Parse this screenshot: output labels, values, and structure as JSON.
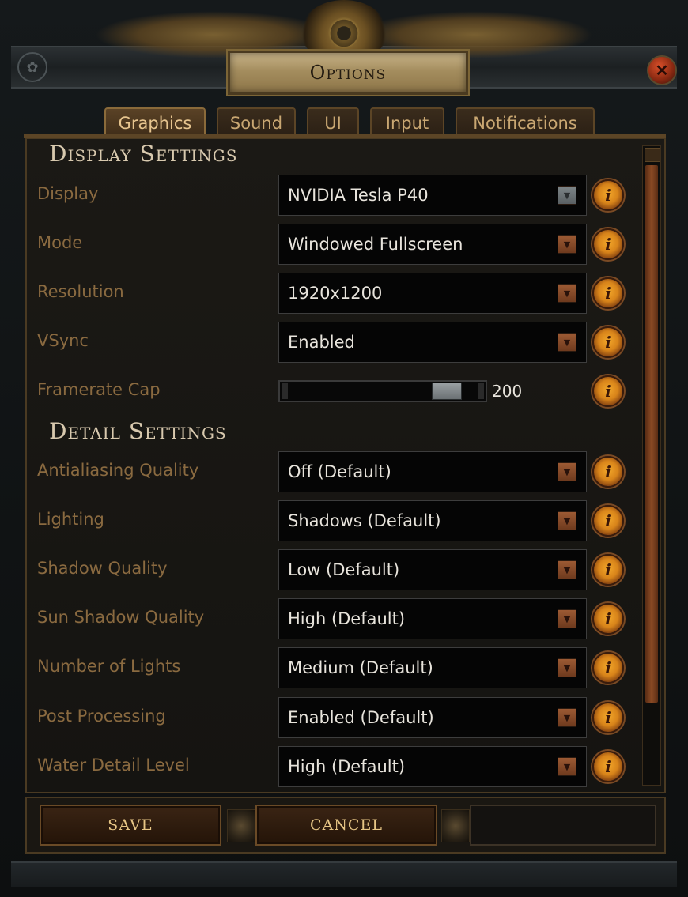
{
  "window": {
    "title": "Options",
    "close_icon": "close-icon"
  },
  "tabs": [
    {
      "label": "Graphics",
      "active": true
    },
    {
      "label": "Sound",
      "active": false
    },
    {
      "label": "UI",
      "active": false
    },
    {
      "label": "Input",
      "active": false
    },
    {
      "label": "Notifications",
      "active": false
    }
  ],
  "sections": {
    "display": {
      "title": "Display Settings"
    },
    "detail": {
      "title": "Detail Settings"
    }
  },
  "display_settings": [
    {
      "label": "Display",
      "value": "NVIDIA Tesla P40"
    },
    {
      "label": "Mode",
      "value": "Windowed Fullscreen"
    },
    {
      "label": "Resolution",
      "value": "1920x1200"
    },
    {
      "label": "VSync",
      "value": "Enabled"
    }
  ],
  "framerate": {
    "label": "Framerate Cap",
    "value": "200",
    "fraction": 0.9
  },
  "detail_settings": [
    {
      "label": "Antialiasing Quality",
      "value": "Off (Default)"
    },
    {
      "label": "Lighting",
      "value": "Shadows (Default)"
    },
    {
      "label": "Shadow Quality",
      "value": "Low (Default)"
    },
    {
      "label": "Sun Shadow Quality",
      "value": "High (Default)"
    },
    {
      "label": "Number of Lights",
      "value": "Medium (Default)"
    },
    {
      "label": "Post Processing",
      "value": "Enabled (Default)"
    },
    {
      "label": "Water Detail Level",
      "value": "High (Default)"
    }
  ],
  "buttons": {
    "save": "SAVE",
    "cancel": "CANCEL"
  },
  "info_glyph": "i",
  "colors": {
    "accent": "#d8841a",
    "label": "#8a6a40",
    "value": "#e8e4dc"
  }
}
